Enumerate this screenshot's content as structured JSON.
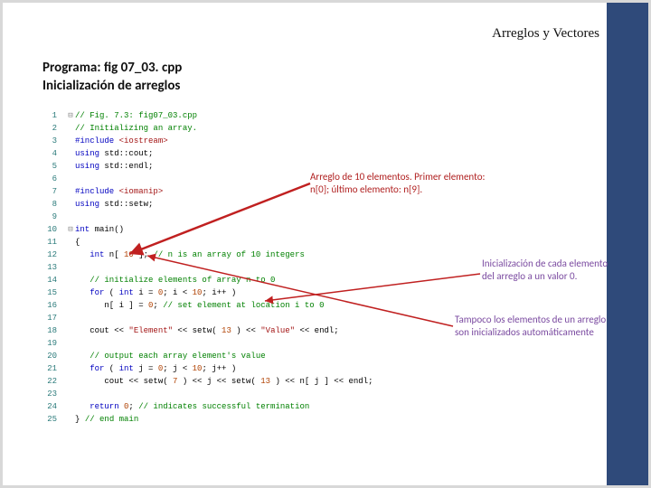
{
  "header": "Arreglos y Vectores",
  "title1": "Programa: fig 07_03. cpp",
  "title2": "Inicialización de arreglos",
  "code": [
    {
      "n": "1",
      "g": "⊟",
      "h": "<span class='c-comment'>// Fig. 7.3: fig07_03.cpp</span>"
    },
    {
      "n": "2",
      "g": "",
      "h": "<span class='c-comment'>// Initializing an array.</span>"
    },
    {
      "n": "3",
      "g": "",
      "h": "<span class='c-pp'>#include</span> <span class='c-str'>&lt;iostream&gt;</span>"
    },
    {
      "n": "4",
      "g": "",
      "h": "<span class='c-kw'>using</span> std::cout;"
    },
    {
      "n": "5",
      "g": "",
      "h": "<span class='c-kw'>using</span> std::endl;"
    },
    {
      "n": "6",
      "g": "",
      "h": ""
    },
    {
      "n": "7",
      "g": "",
      "h": "<span class='c-pp'>#include</span> <span class='c-str'>&lt;iomanip&gt;</span>"
    },
    {
      "n": "8",
      "g": "",
      "h": "<span class='c-kw'>using</span> std::setw;"
    },
    {
      "n": "9",
      "g": "",
      "h": ""
    },
    {
      "n": "10",
      "g": "⊟",
      "h": "<span class='c-type'>int</span> main()"
    },
    {
      "n": "11",
      "g": "",
      "h": "{"
    },
    {
      "n": "12",
      "g": "",
      "h": "   <span class='c-type'>int</span> n[ <span class='c-num'>10</span> ]; <span class='c-comment'>// n is an array of 10 integers</span>"
    },
    {
      "n": "13",
      "g": "",
      "h": ""
    },
    {
      "n": "14",
      "g": "",
      "h": "   <span class='c-comment'>// initialize elements of array n to 0</span>"
    },
    {
      "n": "15",
      "g": "",
      "h": "   <span class='c-kw'>for</span> ( <span class='c-type'>int</span> i = <span class='c-num'>0</span>; i &lt; <span class='c-num'>10</span>; i++ )"
    },
    {
      "n": "16",
      "g": "",
      "h": "      n[ i ] = <span class='c-num'>0</span>; <span class='c-comment'>// set element at location i to 0</span>"
    },
    {
      "n": "17",
      "g": "",
      "h": ""
    },
    {
      "n": "18",
      "g": "",
      "h": "   cout &lt;&lt; <span class='c-str'>\"Element\"</span> &lt;&lt; setw( <span class='c-num'>13</span> ) &lt;&lt; <span class='c-str'>\"Value\"</span> &lt;&lt; endl;"
    },
    {
      "n": "19",
      "g": "",
      "h": ""
    },
    {
      "n": "20",
      "g": "",
      "h": "   <span class='c-comment'>// output each array element's value</span>"
    },
    {
      "n": "21",
      "g": "",
      "h": "   <span class='c-kw'>for</span> ( <span class='c-type'>int</span> j = <span class='c-num'>0</span>; j &lt; <span class='c-num'>10</span>; j++ )"
    },
    {
      "n": "22",
      "g": "",
      "h": "      cout &lt;&lt; setw( <span class='c-num'>7</span> ) &lt;&lt; j &lt;&lt; setw( <span class='c-num'>13</span> ) &lt;&lt; n[ j ] &lt;&lt; endl;"
    },
    {
      "n": "23",
      "g": "",
      "h": ""
    },
    {
      "n": "24",
      "g": "",
      "h": "   <span class='c-kw'>return</span> <span class='c-num'>0</span>; <span class='c-comment'>// indicates successful termination</span>"
    },
    {
      "n": "25",
      "g": "",
      "h": "} <span class='c-comment'>// end main</span>"
    }
  ],
  "callouts": {
    "c1": "Arreglo de 10 elementos. Primer elemento: n[0]; último elemento: n[9].",
    "c2": "Inicialización de cada elemento del arreglo a un valor 0.",
    "c3": "Tampoco los elementos de un arreglo son inicializados automáticamente"
  }
}
